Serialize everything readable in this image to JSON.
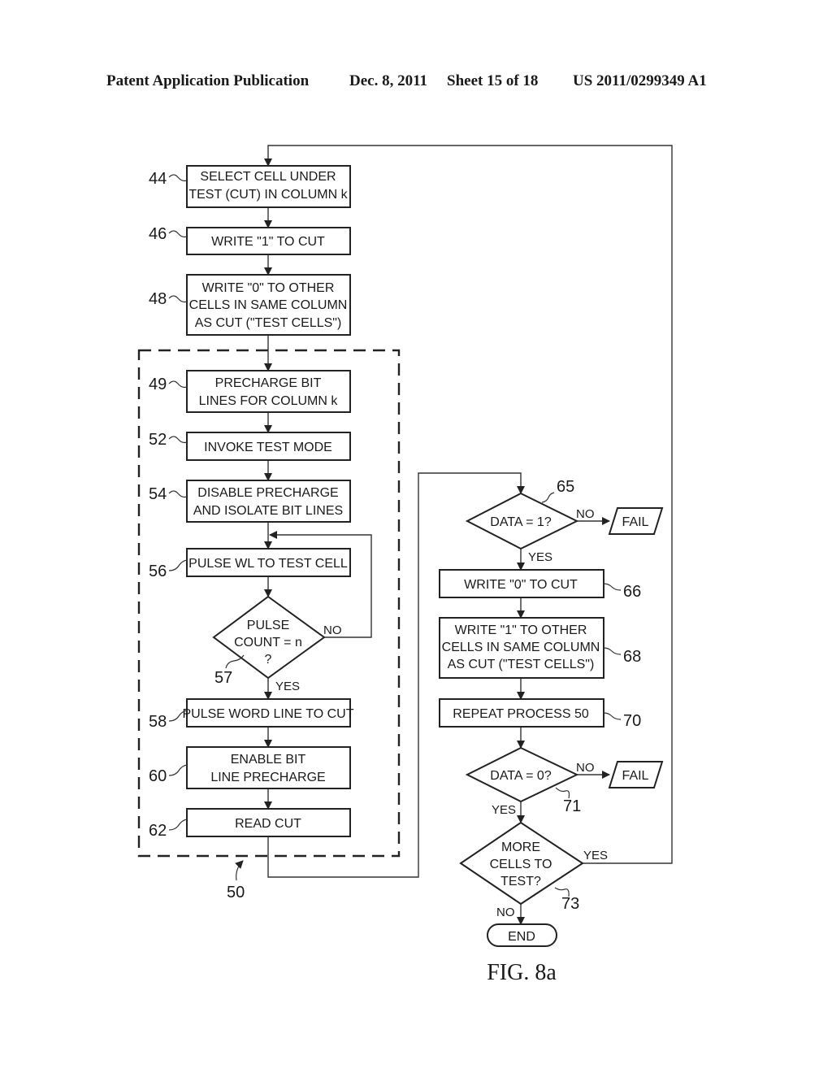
{
  "header": {
    "publication": "Patent Application Publication",
    "date": "Dec. 8, 2011",
    "sheet": "Sheet 15 of 18",
    "number": "US 2011/0299349 A1"
  },
  "figure": {
    "caption": "FIG. 8a"
  },
  "steps": {
    "s44": {
      "ref": "44",
      "lines": [
        "SELECT CELL UNDER",
        "TEST (CUT) IN COLUMN k"
      ]
    },
    "s46": {
      "ref": "46",
      "lines": [
        "WRITE \"1\" TO CUT"
      ]
    },
    "s48": {
      "ref": "48",
      "lines": [
        "WRITE \"0\" TO OTHER",
        "CELLS IN SAME COLUMN",
        "AS CUT (\"TEST CELLS\")"
      ]
    },
    "s49": {
      "ref": "49",
      "lines": [
        "PRECHARGE BIT",
        "LINES FOR COLUMN k"
      ]
    },
    "s52": {
      "ref": "52",
      "lines": [
        "INVOKE TEST MODE"
      ]
    },
    "s54": {
      "ref": "54",
      "lines": [
        "DISABLE PRECHARGE",
        "AND ISOLATE BIT LINES"
      ]
    },
    "s56": {
      "ref": "56",
      "lines": [
        "PULSE WL TO TEST CELL"
      ]
    },
    "s57": {
      "ref": "57",
      "lines": [
        "PULSE",
        "COUNT = n",
        "?"
      ],
      "yes": "YES",
      "no": "NO"
    },
    "s58": {
      "ref": "58",
      "lines": [
        "PULSE WORD LINE TO CUT"
      ]
    },
    "s60": {
      "ref": "60",
      "lines": [
        "ENABLE BIT",
        "LINE PRECHARGE"
      ]
    },
    "s62": {
      "ref": "62",
      "lines": [
        "READ CUT"
      ]
    },
    "group50": {
      "ref": "50"
    },
    "s65": {
      "ref": "65",
      "lines": [
        "DATA = 1?"
      ],
      "yes": "YES",
      "no": "NO",
      "fail": "FAIL"
    },
    "s66": {
      "ref": "66",
      "lines": [
        "WRITE \"0\" TO CUT"
      ]
    },
    "s68": {
      "ref": "68",
      "lines": [
        "WRITE \"1\" TO OTHER",
        "CELLS IN SAME COLUMN",
        "AS CUT (\"TEST CELLS\")"
      ]
    },
    "s70": {
      "ref": "70",
      "lines": [
        "REPEAT PROCESS 50"
      ]
    },
    "s71": {
      "ref": "71",
      "lines": [
        "DATA = 0?"
      ],
      "yes": "YES",
      "no": "NO",
      "fail": "FAIL"
    },
    "s73": {
      "ref": "73",
      "lines": [
        "MORE",
        "CELLS TO",
        "TEST?"
      ],
      "yes": "YES",
      "no": "NO"
    },
    "end": {
      "lines": [
        "END"
      ]
    }
  }
}
